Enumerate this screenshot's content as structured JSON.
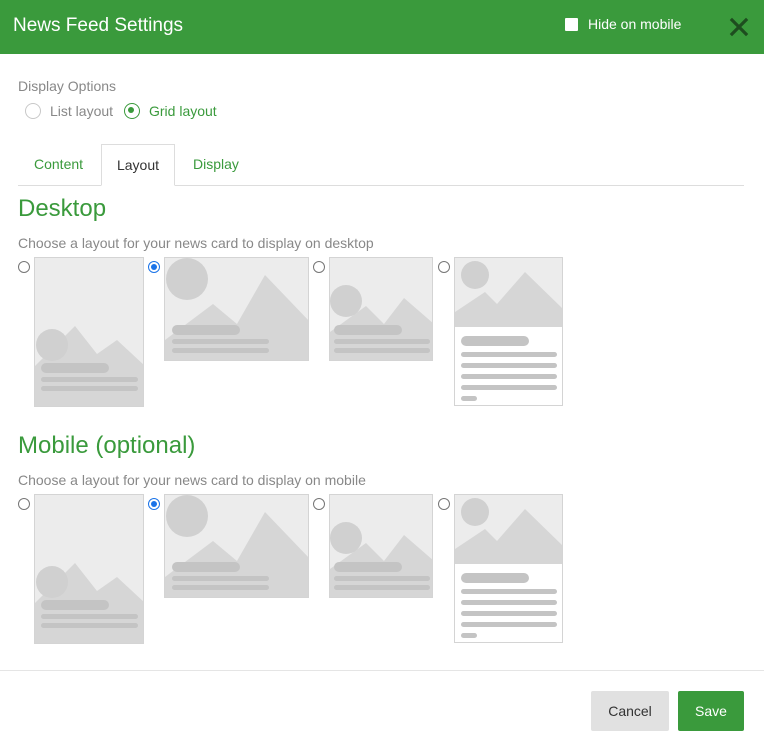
{
  "header": {
    "title": "News Feed Settings",
    "hide_on_mobile_label": "Hide on mobile",
    "hide_on_mobile_checked": false
  },
  "display_options": {
    "label": "Display Options",
    "options": [
      {
        "label": "List layout",
        "selected": false
      },
      {
        "label": "Grid layout",
        "selected": true
      }
    ]
  },
  "tabs": [
    {
      "label": "Content",
      "active": false
    },
    {
      "label": "Layout",
      "active": true
    },
    {
      "label": "Display",
      "active": false
    }
  ],
  "desktop": {
    "heading": "Desktop",
    "description": "Choose a layout for your news card to display on desktop",
    "selected_index": 1
  },
  "mobile": {
    "heading": "Mobile (optional)",
    "description": "Choose a layout for your news card to display on mobile",
    "selected_index": 1
  },
  "footer": {
    "cancel_label": "Cancel",
    "save_label": "Save"
  },
  "colors": {
    "brand_green": "#3a9a3c",
    "radio_blue": "#1a73e8",
    "placeholder_gray": "#ececec"
  }
}
